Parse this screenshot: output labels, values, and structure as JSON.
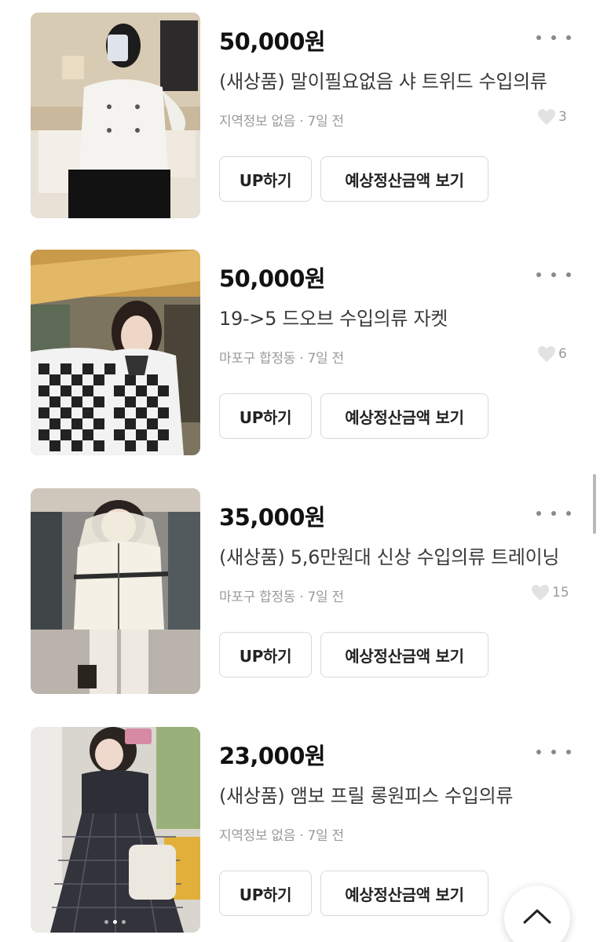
{
  "colors": {
    "price": "#111111",
    "title": "#3a3a3a",
    "meta": "#9a9a9a",
    "button_border": "#d9d9d9"
  },
  "listings": [
    {
      "price": "50,000원",
      "title": "(새상품) 말이필요없음 샤 트위드 수입의류",
      "location": "지역정보 없음",
      "time": "7일 전",
      "likes": "3",
      "up_label": "UP하기",
      "estimate_label": "예상정산금액 보기",
      "thumbnail": "white-tweed-jacket-photo"
    },
    {
      "price": "50,000원",
      "title": "19->5 드오브 수입의류 자켓",
      "location": "마포구 합정동",
      "time": "7일 전",
      "likes": "6",
      "up_label": "UP하기",
      "estimate_label": "예상정산금액 보기",
      "thumbnail": "checkered-jacket-photo"
    },
    {
      "price": "35,000원",
      "title": "(새상품) 5,6만원대 신상 수입의류 트레이닝",
      "location": "마포구 합정동",
      "time": "7일 전",
      "likes": "15",
      "up_label": "UP하기",
      "estimate_label": "예상정산금액 보기",
      "thumbnail": "cream-zip-hoodie-photo"
    },
    {
      "price": "23,000원",
      "title": "(새상품) 앰보 프릴 롱원피스 수입의류",
      "location": "지역정보 없음",
      "time": "7일 전",
      "up_label": "UP하기",
      "estimate_label": "예상정산금액 보기",
      "thumbnail": "checked-long-dress-photo"
    }
  ],
  "separator": "·",
  "icons": {
    "more": "more-dots-icon",
    "like": "heart-icon",
    "scroll_top": "chevron-up-icon"
  }
}
